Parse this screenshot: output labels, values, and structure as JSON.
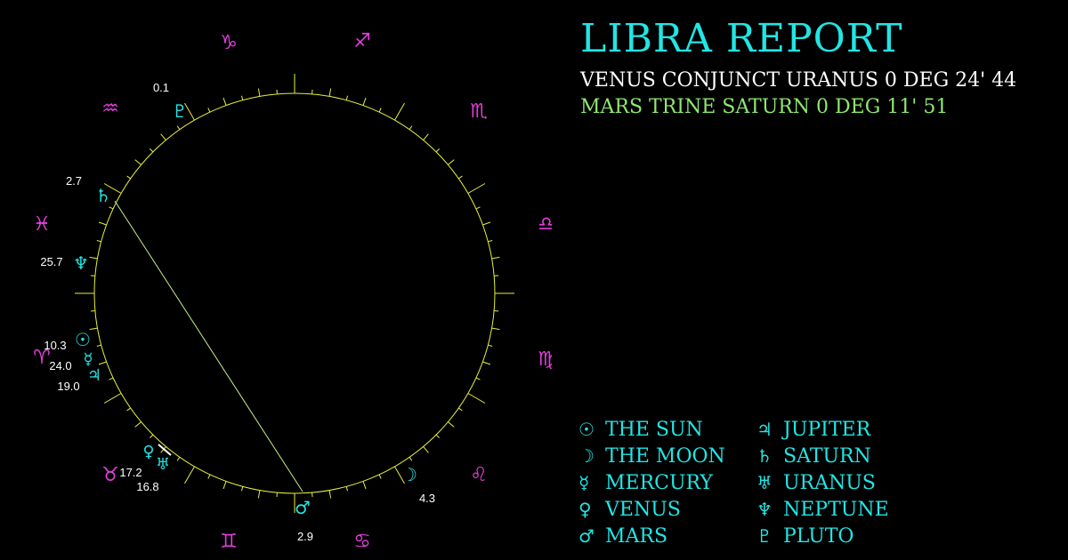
{
  "report": {
    "title": "LIBRA REPORT",
    "aspects": [
      "VENUS CONJUNCT URANUS 0 DEG 24' 44",
      "MARS TRINE SATURN 0 DEG 11' 51"
    ]
  },
  "colors": {
    "background": "#000000",
    "wheel": "#e8f03a",
    "planet": "#22e5e5",
    "sign": "#e43ddc",
    "aspect_white": "#ffffff",
    "aspect_green": "#8fe86f",
    "degree_label": "#ffffff",
    "aspect_line": "#c8f08a"
  },
  "signs": [
    {
      "name": "capricorn",
      "glyph": "♑"
    },
    {
      "name": "sagittarius",
      "glyph": "♐"
    },
    {
      "name": "scorpio",
      "glyph": "♏"
    },
    {
      "name": "libra",
      "glyph": "♎"
    },
    {
      "name": "virgo",
      "glyph": "♍"
    },
    {
      "name": "leo",
      "glyph": "♌"
    },
    {
      "name": "cancer",
      "glyph": "♋"
    },
    {
      "name": "gemini",
      "glyph": "♊"
    },
    {
      "name": "taurus",
      "glyph": "♉"
    },
    {
      "name": "aries",
      "glyph": "♈"
    },
    {
      "name": "pisces",
      "glyph": "♓"
    },
    {
      "name": "aquarius",
      "glyph": "♒"
    }
  ],
  "planets": [
    {
      "name": "pluto",
      "glyph": "♇",
      "degree": "0.1"
    },
    {
      "name": "saturn",
      "glyph": "♄",
      "degree": "2.7"
    },
    {
      "name": "neptune",
      "glyph": "♆",
      "degree": "25.7"
    },
    {
      "name": "sun",
      "glyph": "☉",
      "degree": "10.3"
    },
    {
      "name": "mercury",
      "glyph": "☿",
      "degree": "24.0"
    },
    {
      "name": "jupiter",
      "glyph": "♃",
      "degree": "19.0"
    },
    {
      "name": "venus",
      "glyph": "♀",
      "degree": "17.2"
    },
    {
      "name": "uranus",
      "glyph": "♅",
      "degree": "16.8"
    },
    {
      "name": "mars",
      "glyph": "♂",
      "degree": "2.9"
    },
    {
      "name": "moon",
      "glyph": "☽",
      "degree": "4.3"
    }
  ],
  "legend": [
    {
      "glyph": "☉",
      "label": "THE SUN"
    },
    {
      "glyph": "☽",
      "label": "THE MOON"
    },
    {
      "glyph": "☿",
      "label": "MERCURY"
    },
    {
      "glyph": "♀",
      "label": "VENUS"
    },
    {
      "glyph": "♂",
      "label": "MARS"
    },
    {
      "glyph": "♃",
      "label": "JUPITER"
    },
    {
      "glyph": "♄",
      "label": "SATURN"
    },
    {
      "glyph": "♅",
      "label": "URANUS"
    },
    {
      "glyph": "♆",
      "label": "NEPTUNE"
    },
    {
      "glyph": "♇",
      "label": "PLUTO"
    }
  ]
}
